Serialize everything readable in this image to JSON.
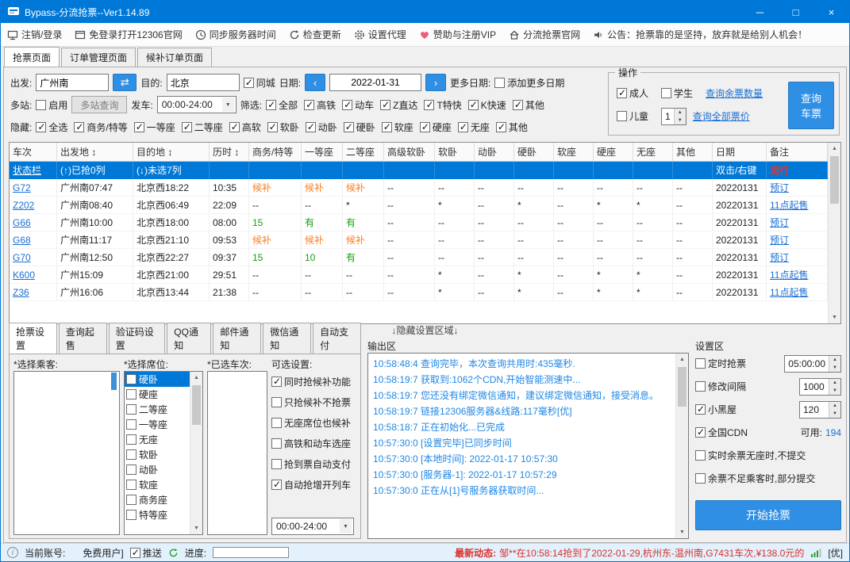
{
  "colors": {
    "titlebar": "#0078D7",
    "accent": "#2F8FE4",
    "link": "#1A6FD4",
    "sel": "#0078D7",
    "orange": "#FF7D1F",
    "green": "#12A012",
    "red": "#E5342E",
    "log": "#1E87E5",
    "news": "#D9302C",
    "sbarbg": "#E2F1FC"
  },
  "window": {
    "title": "Bypass-分流抢票--Ver1.14.89",
    "minimize": "─",
    "maximize": "□",
    "close": "×"
  },
  "toolbar": {
    "items": [
      "注销/登录",
      "免登录打开12306官网",
      "同步服务器时间",
      "检查更新",
      "设置代理",
      "赞助与注册VIP",
      "分流抢票官网",
      "公告：抢票靠的是坚持，放弃就是给别人机会！"
    ]
  },
  "main_tabs": [
    {
      "label": "抢票页面",
      "cls": "active"
    },
    {
      "label": "订单管理页面",
      "cls": ""
    },
    {
      "label": "候补订单页面",
      "cls": ""
    }
  ],
  "query": {
    "depart_label": "出发:",
    "depart_value": "广州南",
    "swap_label": "⇄",
    "dest_label": "目的:",
    "dest_value": "北京",
    "same_city": {
      "label": "同城",
      "state": "checked"
    },
    "date_label": "日期:",
    "date_prev": "‹",
    "date_value": "2022-01-31",
    "date_next": "›",
    "more_dates_label": "更多日期:",
    "add_more_dates": {
      "label": "添加更多日期",
      "state": ""
    },
    "multi_label": "多站:",
    "multi_enable": {
      "label": "启用",
      "state": ""
    },
    "multi_btn": "多站查询",
    "depart_time_label": "发车:",
    "depart_time_value": "00:00-24:00",
    "filter_label": "筛选:",
    "filters": [
      {
        "label": "全部",
        "state": "checked"
      },
      {
        "label": "高铁",
        "state": "checked"
      },
      {
        "label": "动车",
        "state": "checked"
      },
      {
        "label": "Z直达",
        "state": "checked"
      },
      {
        "label": "T特快",
        "state": "checked"
      },
      {
        "label": "K快速",
        "state": "checked"
      },
      {
        "label": "其他",
        "state": "checked"
      }
    ],
    "hide_label": "隐藏:",
    "hides": [
      {
        "label": "全选",
        "state": "checked"
      },
      {
        "label": "商务/特等",
        "state": "checked"
      },
      {
        "label": "一等座",
        "state": "checked"
      },
      {
        "label": "二等座",
        "state": "checked"
      },
      {
        "label": "高软",
        "state": "checked"
      },
      {
        "label": "软卧",
        "state": "checked"
      },
      {
        "label": "动卧",
        "state": "checked"
      },
      {
        "label": "硬卧",
        "state": "checked"
      },
      {
        "label": "软座",
        "state": "checked"
      },
      {
        "label": "硬座",
        "state": "checked"
      },
      {
        "label": "无座",
        "state": "checked"
      },
      {
        "label": "其他",
        "state": "checked"
      }
    ]
  },
  "operation": {
    "title": "操作",
    "adult": {
      "label": "成人",
      "state": "checked"
    },
    "student": {
      "label": "学生",
      "state": ""
    },
    "child": {
      "label": "儿童",
      "state": ""
    },
    "child_count": "1",
    "link_count": "查询余票数量",
    "link_price": "查询全部票价",
    "query_btn": "查询\n车票"
  },
  "table": {
    "columns": [
      "车次",
      "出发地 ↕",
      "目的地 ↕",
      "历时 ↕",
      "商务/特等",
      "一等座",
      "二等座",
      "高级软卧",
      "软卧",
      "动卧",
      "硬卧",
      "软座",
      "硬座",
      "无座",
      "其他",
      "日期",
      "备注"
    ],
    "rows": [
      {
        "cls": "sel",
        "cells": [
          {
            "t": "状态栏",
            "c": "c-wlink",
            "i": "true"
          },
          {
            "t": "(↑)已抢0列"
          },
          {
            "t": "(↓)未选7列"
          },
          {
            "t": ""
          },
          {
            "t": ""
          },
          {
            "t": ""
          },
          {
            "t": ""
          },
          {
            "t": ""
          },
          {
            "t": ""
          },
          {
            "t": ""
          },
          {
            "t": ""
          },
          {
            "t": ""
          },
          {
            "t": ""
          },
          {
            "t": ""
          },
          {
            "t": ""
          },
          {
            "t": "双击/右键"
          },
          {
            "t": "运行",
            "c": "c-red",
            "i": "true"
          }
        ]
      },
      {
        "cls": "",
        "cells": [
          {
            "t": "G72",
            "c": "c-link",
            "i": "true"
          },
          {
            "t": "广州南07:47"
          },
          {
            "t": "北京西18:22"
          },
          {
            "t": "10:35"
          },
          {
            "t": "候补",
            "c": "c-orange"
          },
          {
            "t": "候补",
            "c": "c-orange"
          },
          {
            "t": "候补",
            "c": "c-orange"
          },
          {
            "t": "--"
          },
          {
            "t": "--"
          },
          {
            "t": "--"
          },
          {
            "t": "--"
          },
          {
            "t": "--"
          },
          {
            "t": "--"
          },
          {
            "t": "--"
          },
          {
            "t": "--"
          },
          {
            "t": "20220131"
          },
          {
            "t": "预订",
            "c": "c-link",
            "i": "true"
          }
        ]
      },
      {
        "cls": "",
        "cells": [
          {
            "t": "Z202",
            "c": "c-link",
            "i": "true"
          },
          {
            "t": "广州南08:40"
          },
          {
            "t": "北京西06:49"
          },
          {
            "t": "22:09"
          },
          {
            "t": "--"
          },
          {
            "t": "--"
          },
          {
            "t": "*"
          },
          {
            "t": "--"
          },
          {
            "t": "*"
          },
          {
            "t": "--"
          },
          {
            "t": "*"
          },
          {
            "t": "--"
          },
          {
            "t": "*"
          },
          {
            "t": "*"
          },
          {
            "t": "--"
          },
          {
            "t": "20220131"
          },
          {
            "t": "11点起售",
            "c": "c-link",
            "i": "true"
          }
        ]
      },
      {
        "cls": "",
        "cells": [
          {
            "t": "G66",
            "c": "c-link",
            "i": "true"
          },
          {
            "t": "广州南10:00"
          },
          {
            "t": "北京西18:00"
          },
          {
            "t": "08:00"
          },
          {
            "t": "15",
            "c": "c-green"
          },
          {
            "t": "有",
            "c": "c-green"
          },
          {
            "t": "有",
            "c": "c-green"
          },
          {
            "t": "--"
          },
          {
            "t": "--"
          },
          {
            "t": "--"
          },
          {
            "t": "--"
          },
          {
            "t": "--"
          },
          {
            "t": "--"
          },
          {
            "t": "--"
          },
          {
            "t": "--"
          },
          {
            "t": "20220131"
          },
          {
            "t": "预订",
            "c": "c-link",
            "i": "true"
          }
        ]
      },
      {
        "cls": "",
        "cells": [
          {
            "t": "G68",
            "c": "c-link",
            "i": "true"
          },
          {
            "t": "广州南11:17"
          },
          {
            "t": "北京西21:10"
          },
          {
            "t": "09:53"
          },
          {
            "t": "候补",
            "c": "c-orange"
          },
          {
            "t": "候补",
            "c": "c-orange"
          },
          {
            "t": "候补",
            "c": "c-orange"
          },
          {
            "t": "--"
          },
          {
            "t": "--"
          },
          {
            "t": "--"
          },
          {
            "t": "--"
          },
          {
            "t": "--"
          },
          {
            "t": "--"
          },
          {
            "t": "--"
          },
          {
            "t": "--"
          },
          {
            "t": "20220131"
          },
          {
            "t": "预订",
            "c": "c-link",
            "i": "true"
          }
        ]
      },
      {
        "cls": "",
        "cells": [
          {
            "t": "G70",
            "c": "c-link",
            "i": "true"
          },
          {
            "t": "广州南12:50"
          },
          {
            "t": "北京西22:27"
          },
          {
            "t": "09:37"
          },
          {
            "t": "15",
            "c": "c-green"
          },
          {
            "t": "10",
            "c": "c-green"
          },
          {
            "t": "有",
            "c": "c-green"
          },
          {
            "t": "--"
          },
          {
            "t": "--"
          },
          {
            "t": "--"
          },
          {
            "t": "--"
          },
          {
            "t": "--"
          },
          {
            "t": "--"
          },
          {
            "t": "--"
          },
          {
            "t": "--"
          },
          {
            "t": "20220131"
          },
          {
            "t": "预订",
            "c": "c-link",
            "i": "true"
          }
        ]
      },
      {
        "cls": "",
        "cells": [
          {
            "t": "K600",
            "c": "c-link",
            "i": "true"
          },
          {
            "t": "广州15:09"
          },
          {
            "t": "北京西21:00"
          },
          {
            "t": "29:51"
          },
          {
            "t": "--"
          },
          {
            "t": "--"
          },
          {
            "t": "--"
          },
          {
            "t": "--"
          },
          {
            "t": "*"
          },
          {
            "t": "--"
          },
          {
            "t": "*"
          },
          {
            "t": "--"
          },
          {
            "t": "*"
          },
          {
            "t": "*"
          },
          {
            "t": "--"
          },
          {
            "t": "20220131"
          },
          {
            "t": "11点起售",
            "c": "c-link",
            "i": "true"
          }
        ]
      },
      {
        "cls": "",
        "cells": [
          {
            "t": "Z36",
            "c": "c-link",
            "i": "true"
          },
          {
            "t": "广州16:06"
          },
          {
            "t": "北京西13:44"
          },
          {
            "t": "21:38"
          },
          {
            "t": "--"
          },
          {
            "t": "--"
          },
          {
            "t": "--"
          },
          {
            "t": "--"
          },
          {
            "t": "*"
          },
          {
            "t": "--"
          },
          {
            "t": "*"
          },
          {
            "t": "--"
          },
          {
            "t": "*"
          },
          {
            "t": "*"
          },
          {
            "t": "--"
          },
          {
            "t": "20220131"
          },
          {
            "t": "11点起售",
            "c": "c-link",
            "i": "true"
          }
        ]
      }
    ]
  },
  "divider_label": "↓隐藏设置区域↓",
  "bottom_tabs": [
    {
      "label": "抢票设置",
      "cls": "active"
    },
    {
      "label": "查询起售",
      "cls": ""
    },
    {
      "label": "验证码设置",
      "cls": ""
    },
    {
      "label": "QQ通知",
      "cls": ""
    },
    {
      "label": "邮件通知",
      "cls": ""
    },
    {
      "label": "微信通知",
      "cls": ""
    },
    {
      "label": "自动支付",
      "cls": ""
    }
  ],
  "grab": {
    "passengers_label": "*选择乘客:",
    "seats_label": "*选择席位:",
    "seats": [
      {
        "label": "硬卧",
        "state": "",
        "cls": "sel"
      },
      {
        "label": "硬座",
        "state": "",
        "cls": ""
      },
      {
        "label": "二等座",
        "state": "",
        "cls": ""
      },
      {
        "label": "一等座",
        "state": "",
        "cls": ""
      },
      {
        "label": "无座",
        "state": "",
        "cls": ""
      },
      {
        "label": "软卧",
        "state": "",
        "cls": ""
      },
      {
        "label": "动卧",
        "state": "",
        "cls": ""
      },
      {
        "label": "软座",
        "state": "",
        "cls": ""
      },
      {
        "label": "商务座",
        "state": "",
        "cls": ""
      },
      {
        "label": "特等座",
        "state": "",
        "cls": ""
      }
    ],
    "trains_label": "*已选车次:",
    "options_label": "可选设置:",
    "options": [
      {
        "label": "同时抢候补功能",
        "state": "checked"
      },
      {
        "label": "只抢候补不抢票",
        "state": ""
      },
      {
        "label": "无座席位也候补",
        "state": ""
      },
      {
        "label": "高铁和动车选座",
        "state": ""
      },
      {
        "label": "抢到票自动支付",
        "state": ""
      },
      {
        "label": "自动抢增开列车",
        "state": "checked"
      }
    ],
    "time_range": "00:00-24:00"
  },
  "output": {
    "label": "输出区",
    "lines": [
      "10:58:48:4  查询完毕，本次查询共用时:435毫秒.",
      "10:58:19:7  获取到:1062个CDN,开始智能测速中...",
      "10:58:19:7  您还没有绑定微信通知，建议绑定微信通知，接受消息。",
      "10:58:19:7  链接12306服务器&线路:117毫秒[优]",
      "10:58:18:7  正在初始化...已完成",
      "10:57:30:0  [设置完毕]已同步时间",
      "10:57:30:0  [本地时间]: 2022-01-17 10:57:30",
      "10:57:30:0  [服务器-1]:  2022-01-17 10:57:29",
      "10:57:30:0  正在从[1]号服务器获取时间..."
    ]
  },
  "settings": {
    "label": "设置区",
    "timed": {
      "label": "定时抢票",
      "state": "",
      "value": "05:00:00"
    },
    "interval": {
      "label": "修改间隔",
      "state": "",
      "value": "1000"
    },
    "blackroom": {
      "label": "小黑屋",
      "state": "checked",
      "value": "120"
    },
    "cdn": {
      "label": "全国CDN",
      "state": "checked",
      "avail_label": "可用:",
      "avail_value": "194"
    },
    "noseat": {
      "label": "实时余票无座时,不提交",
      "state": ""
    },
    "partial": {
      "label": "余票不足乘客时,部分提交",
      "state": ""
    },
    "start_btn": "开始抢票"
  },
  "statusbar": {
    "account_label": "当前账号:",
    "account_value": "免费用户]",
    "push": {
      "label": "推送",
      "state": "checked"
    },
    "progress_label": "进度:",
    "news_label": "最新动态:",
    "news_text": "邹**在10:58:14抢到了2022-01-29,杭州东-温州南,G7431车次,¥138.0元的",
    "signal_label": "[优]"
  }
}
